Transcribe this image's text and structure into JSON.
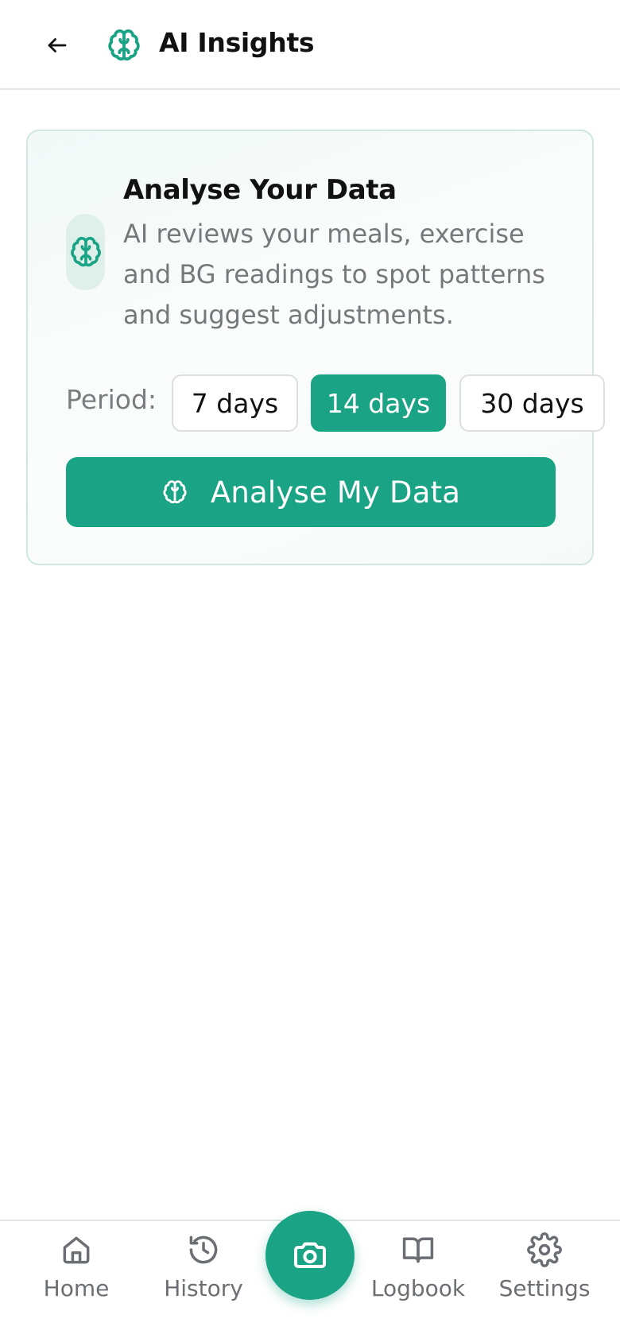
{
  "header": {
    "title": "AI Insights",
    "back_icon": "arrow-left-icon",
    "brand_icon": "brain-icon"
  },
  "card": {
    "title": "Analyse Your Data",
    "description": "AI reviews your meals, exercise and BG readings to spot patterns and suggest adjustments.",
    "period_label": "Period:",
    "periods": [
      {
        "label": "7 days",
        "selected": false
      },
      {
        "label": "14 days",
        "selected": true
      },
      {
        "label": "30 days",
        "selected": false
      }
    ],
    "analyse_button_label": "Analyse My Data"
  },
  "bottom_nav": {
    "items": [
      {
        "label": "Home",
        "icon": "home-icon"
      },
      {
        "label": "History",
        "icon": "history-icon"
      },
      {
        "label": "Logbook",
        "icon": "book-icon"
      },
      {
        "label": "Settings",
        "icon": "gear-icon"
      }
    ],
    "fab_icon": "camera-icon"
  },
  "colors": {
    "accent": "#1ba385",
    "card_border": "#cfe8e1",
    "muted_text": "#76797c"
  }
}
